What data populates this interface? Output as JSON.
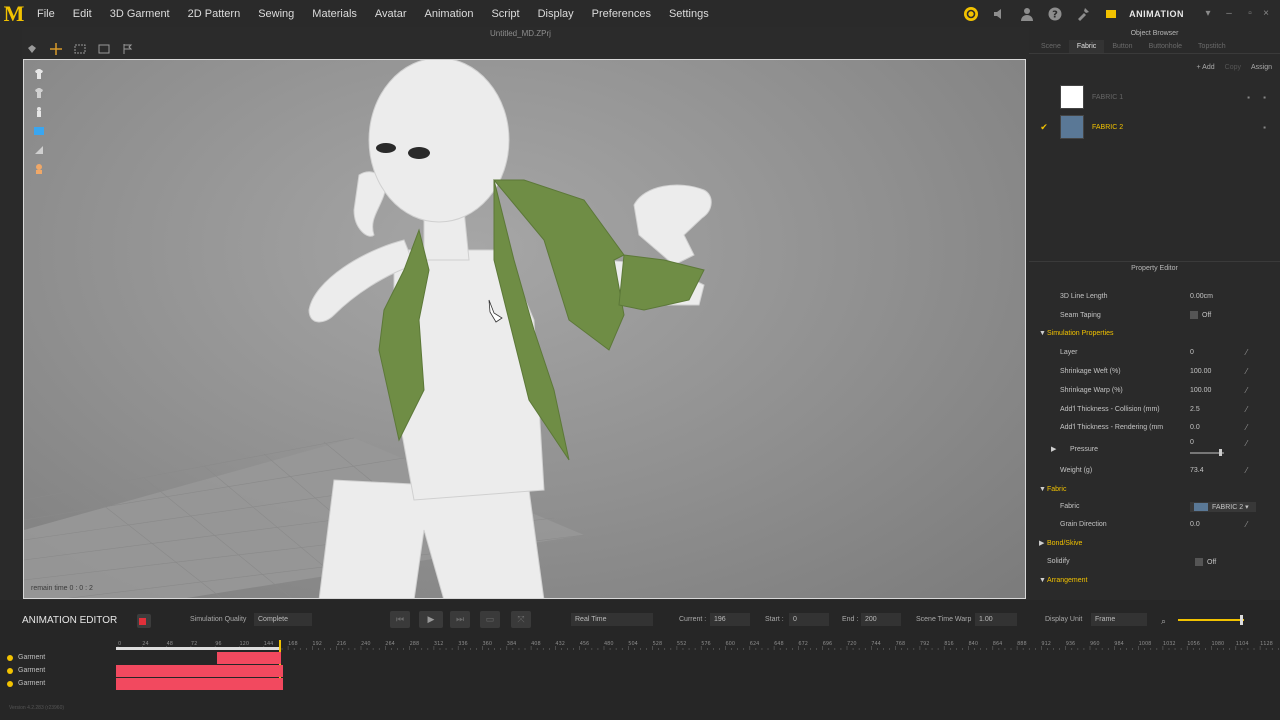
{
  "menubar": {
    "logo": "M",
    "items": [
      "File",
      "Edit",
      "3D Garment",
      "2D Pattern",
      "Sewing",
      "Materials",
      "Avatar",
      "Animation",
      "Script",
      "Display",
      "Preferences",
      "Settings"
    ],
    "mode": "ANIMATION"
  },
  "document": {
    "title": "Untitled_MD.ZPrj"
  },
  "viewport": {
    "remain_time": "remain time 0 : 0 : 2"
  },
  "object_browser": {
    "title": "Object Browser",
    "tabs": [
      "Scene",
      "Fabric",
      "Button",
      "Buttonhole",
      "Topstitch"
    ],
    "active_tab": "Fabric",
    "actions": {
      "add": "+ Add",
      "copy": "Copy",
      "assign": "Assign"
    },
    "fabrics": [
      {
        "name": "FABRIC 1",
        "color": "#ffffff",
        "selected": false
      },
      {
        "name": "FABRIC 2",
        "color": "#5a7896",
        "selected": true
      }
    ]
  },
  "property_editor": {
    "title": "Property Editor",
    "rows": {
      "line_length": {
        "label": "3D Line Length",
        "value": "0.00cm"
      },
      "seam_taping": {
        "label": "Seam Taping",
        "value": "Off"
      },
      "sim_section": "Simulation Properties",
      "layer": {
        "label": "Layer",
        "value": "0"
      },
      "shrink_weft": {
        "label": "Shrinkage Weft (%)",
        "value": "100.00"
      },
      "shrink_warp": {
        "label": "Shrinkage Warp (%)",
        "value": "100.00"
      },
      "thick_collision": {
        "label": "Add'l Thickness - Collision (mm)",
        "value": "2.5"
      },
      "thick_render": {
        "label": "Add'l Thickness - Rendering (mm",
        "value": "0.0"
      },
      "pressure": {
        "label": "Pressure",
        "value": "0"
      },
      "weight": {
        "label": "Weight (g)",
        "value": "73.4"
      },
      "fabric_section": "Fabric",
      "fabric": {
        "label": "Fabric",
        "value": "FABRIC 2"
      },
      "grain": {
        "label": "Grain Direction",
        "value": "0.0"
      },
      "bond_section": "Bond/Skive",
      "solidify": {
        "label": "Solidify",
        "value": "Off"
      },
      "arrangement_section": "Arrangement"
    }
  },
  "animation_editor": {
    "title": "ANIMATION EDITOR",
    "sim_quality_label": "Simulation Quality",
    "sim_quality_value": "Complete",
    "speed_value": "Real Time",
    "current_label": "Current :",
    "current_value": "196",
    "start_label": "Start :",
    "start_value": "0",
    "end_label": "End :",
    "end_value": "200",
    "time_warp_label": "Scene Time Warp",
    "time_warp_value": "1.00",
    "display_unit_label": "Display Unit",
    "display_unit_value": "Frame",
    "ticks": [
      "0",
      "24",
      "48",
      "72",
      "96",
      "120",
      "144",
      "168",
      "192",
      "216",
      "240",
      "264",
      "288",
      "312",
      "336",
      "360",
      "384",
      "408",
      "432",
      "456",
      "480",
      "504",
      "528",
      "552",
      "576",
      "600",
      "624",
      "648",
      "672",
      "696",
      "720",
      "744",
      "768",
      "792",
      "816",
      "840",
      "864",
      "888",
      "912",
      "936",
      "960",
      "984",
      "1008",
      "1032",
      "1056",
      "1080",
      "1104",
      "1128"
    ],
    "tracks": [
      {
        "label": "Garment"
      },
      {
        "label": "Garment"
      },
      {
        "label": "Garment"
      }
    ],
    "version": "Version 4.2.283 (r23960)"
  },
  "colors": {
    "accent": "#f2c200",
    "track": "#f2495f",
    "jacket": "#6f8d45"
  }
}
